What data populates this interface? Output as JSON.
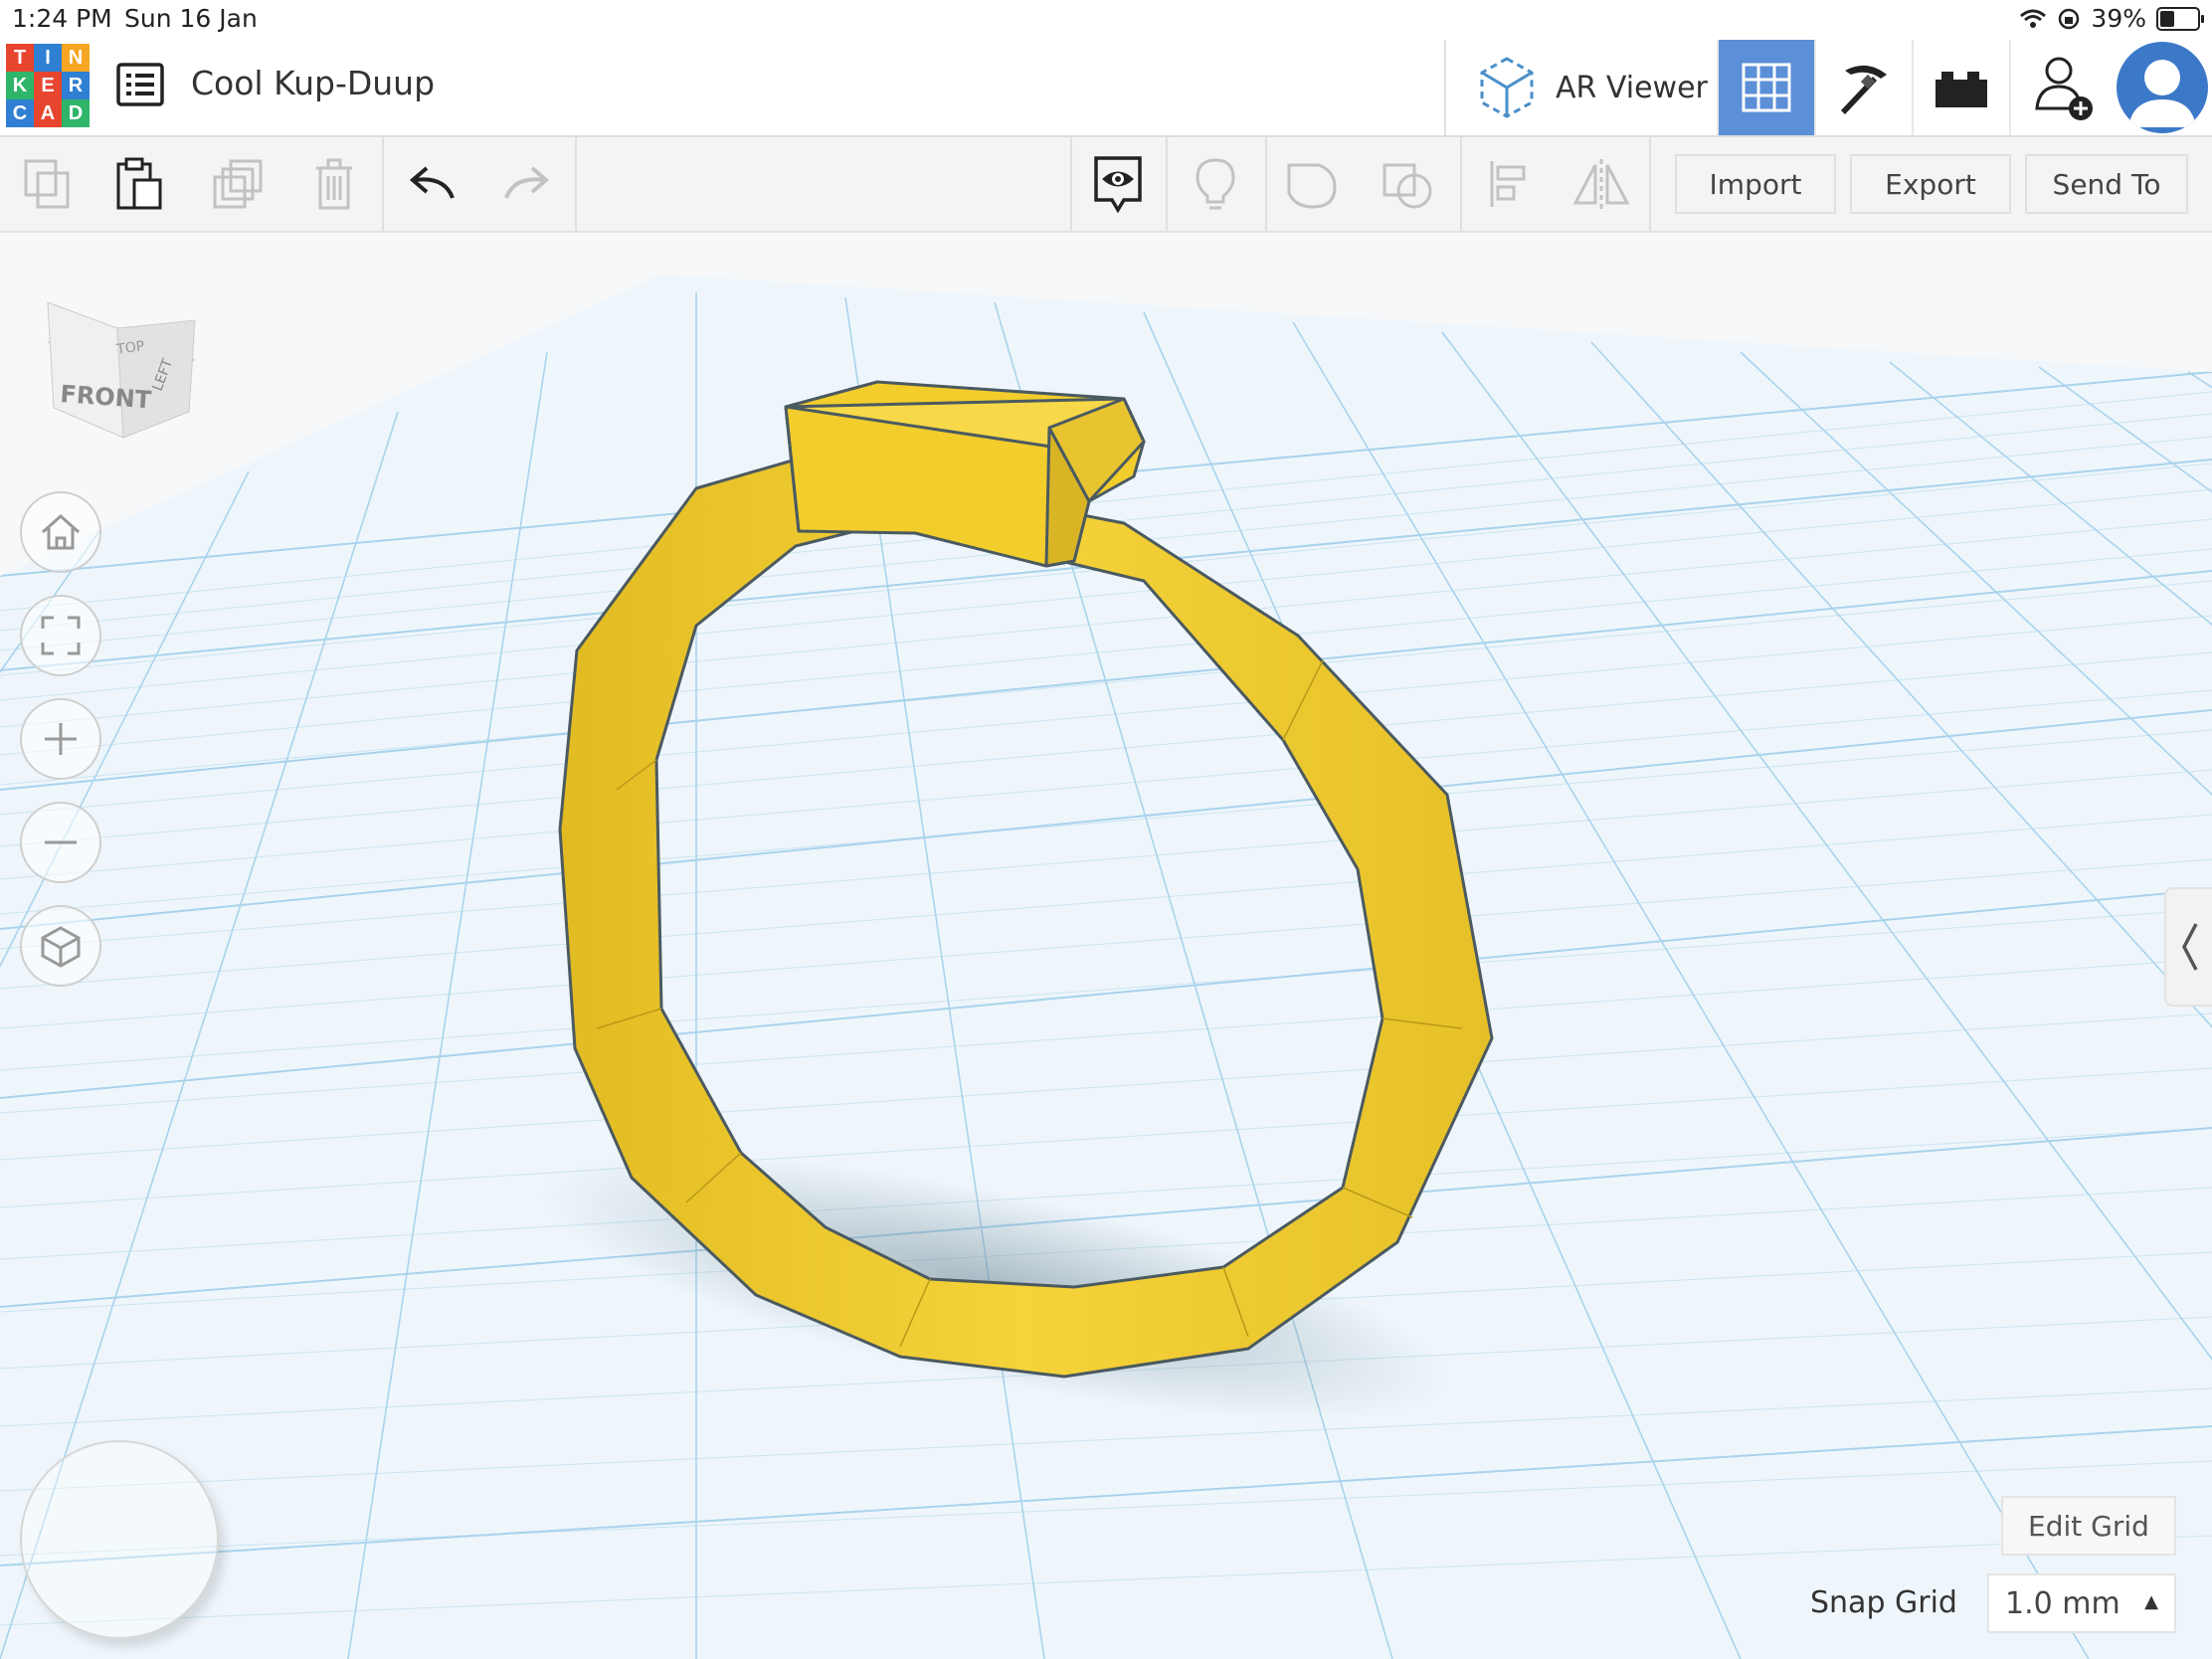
{
  "status_bar": {
    "time": "1:24 PM",
    "date": "Sun 16 Jan",
    "battery": "39%"
  },
  "logo": {
    "letters": [
      "T",
      "I",
      "N",
      "K",
      "E",
      "R",
      "C",
      "A",
      "D"
    ],
    "colors": [
      "#e8452f",
      "#2f7fd3",
      "#f6a623",
      "#2f7fd3",
      "#e8452f",
      "#2fb56a",
      "#2f7fd3",
      "#e8452f",
      "#2f7fd3"
    ]
  },
  "header": {
    "project_title": "Cool Kup-Duup",
    "ar_viewer_label": "AR Viewer",
    "active_view": "3D Design (grid)",
    "accent": "#5b8fd7"
  },
  "toolbar": {
    "import_label": "Import",
    "export_label": "Export",
    "send_to_label": "Send To"
  },
  "view_cube": {
    "top": "TOP",
    "front": "FRONT",
    "side": "LEFT"
  },
  "nav_controls": [
    "home-view",
    "fit-all",
    "zoom-in",
    "zoom-out",
    "orthographic-perspective"
  ],
  "grid": {
    "edit_grid_label": "Edit Grid",
    "snap_grid_label": "Snap Grid",
    "snap_grid_value": "1.0 mm"
  },
  "scene": {
    "object": "ring",
    "object_color": "#f2cd2c",
    "grid_color": "#a9d3ec"
  }
}
